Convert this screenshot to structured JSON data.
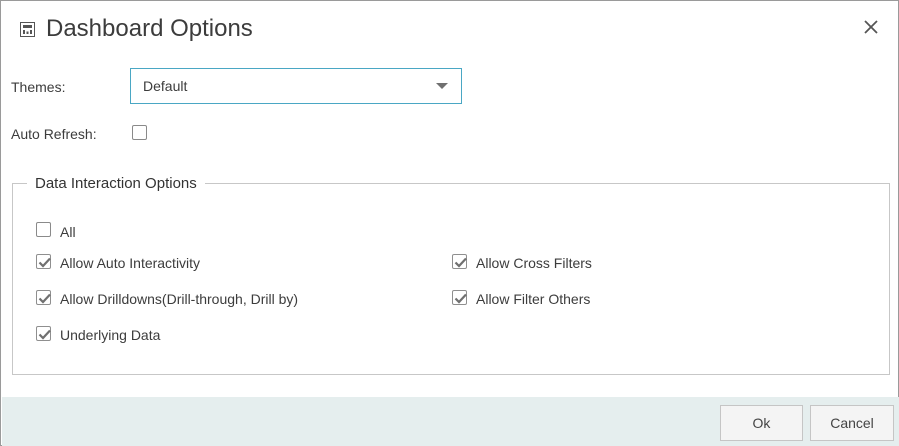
{
  "dialog": {
    "title": "Dashboard Options",
    "title_icon": "dashboard-icon",
    "close_icon": "close-icon"
  },
  "themes": {
    "label": "Themes:",
    "selected": "Default"
  },
  "auto_refresh": {
    "label": "Auto Refresh:",
    "checked": false
  },
  "interaction": {
    "legend": "Data Interaction Options",
    "all": {
      "label": "All",
      "checked": false
    },
    "auto_interactivity": {
      "label": "Allow Auto Interactivity",
      "checked": true
    },
    "drilldowns": {
      "label": "Allow Drilldowns(Drill-through, Drill by)",
      "checked": true
    },
    "underlying_data": {
      "label": "Underlying Data",
      "checked": true
    },
    "cross_filters": {
      "label": "Allow Cross Filters",
      "checked": true
    },
    "filter_others": {
      "label": "Allow Filter Others",
      "checked": true
    }
  },
  "footer": {
    "ok_label": "Ok",
    "cancel_label": "Cancel"
  },
  "colors": {
    "select_border": "#4aa7c4",
    "footer_bg": "#e5eeee",
    "check_mark": "#707070"
  }
}
